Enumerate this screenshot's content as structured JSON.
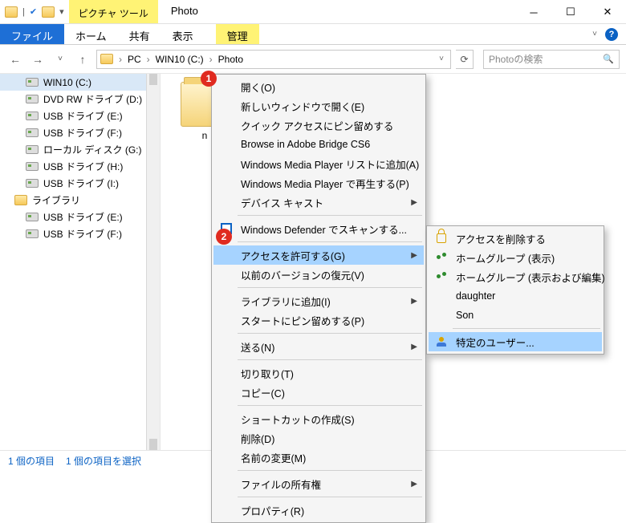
{
  "window": {
    "tool_tab": "ピクチャ ツール",
    "title": "Photo",
    "qat_check": "✔",
    "qat_sep": "|",
    "qat_drop": "▾"
  },
  "ribbon": {
    "file": "ファイル",
    "home": "ホーム",
    "share": "共有",
    "view": "表示",
    "manage": "管理",
    "help": "?"
  },
  "nav": {
    "back": "←",
    "fwd": "→",
    "recent": "˅",
    "up": "↑"
  },
  "breadcrumb": {
    "level1": "PC",
    "level2": "WIN10 (C:)",
    "level3": "Photo",
    "sep": "›",
    "drop": "˅",
    "refresh": "⟳"
  },
  "search": {
    "placeholder": "Photoの検索",
    "icon": "🔍"
  },
  "tree": {
    "items": [
      "WIN10 (C:)",
      "DVD RW ドライブ (D:)",
      "USB ドライブ (E:)",
      "USB ドライブ (F:)",
      "ローカル ディスク (G:)",
      "USB ドライブ (H:)",
      "USB ドライブ (I:)"
    ],
    "lib": "ライブラリ",
    "lib_items": [
      "USB ドライブ (E:)",
      "USB ドライブ (F:)"
    ]
  },
  "status": {
    "count": "1 個の項目",
    "selected": "1 個の項目を選択"
  },
  "folder": {
    "name": "n"
  },
  "ctx": {
    "groups": [
      [
        "開く(O)",
        "新しいウィンドウで開く(E)",
        "クイック アクセスにピン留めする",
        "Browse in Adobe Bridge CS6",
        "Windows Media Player リストに追加(A)",
        "Windows Media Player で再生する(P)",
        "デバイス キャスト"
      ],
      [
        "Windows Defender でスキャンする..."
      ],
      [
        "アクセスを許可する(G)",
        "以前のバージョンの復元(V)"
      ],
      [
        "ライブラリに追加(I)",
        "スタートにピン留めする(P)"
      ],
      [
        "送る(N)"
      ],
      [
        "切り取り(T)",
        "コピー(C)"
      ],
      [
        "ショートカットの作成(S)",
        "削除(D)",
        "名前の変更(M)"
      ],
      [
        "ファイルの所有権"
      ],
      [
        "プロパティ(R)"
      ]
    ],
    "arrow_items": [
      "デバイス キャスト",
      "アクセスを許可する(G)",
      "ライブラリに追加(I)",
      "送る(N)",
      "ファイルの所有権"
    ],
    "selected_item": "アクセスを許可する(G)",
    "defender_icon_item": "Windows Defender でスキャンする..."
  },
  "sub": {
    "items": [
      {
        "label": "アクセスを削除する",
        "icon": "lock"
      },
      {
        "label": "ホームグループ (表示)",
        "icon": "share"
      },
      {
        "label": "ホームグループ (表示および編集)",
        "icon": "share"
      },
      {
        "label": "daughter",
        "icon": ""
      },
      {
        "label": "Son",
        "icon": ""
      }
    ],
    "sep_then": {
      "label": "特定のユーザー...",
      "icon": "user"
    },
    "selected": "特定のユーザー..."
  },
  "badges": {
    "one": "1",
    "two": "2"
  }
}
